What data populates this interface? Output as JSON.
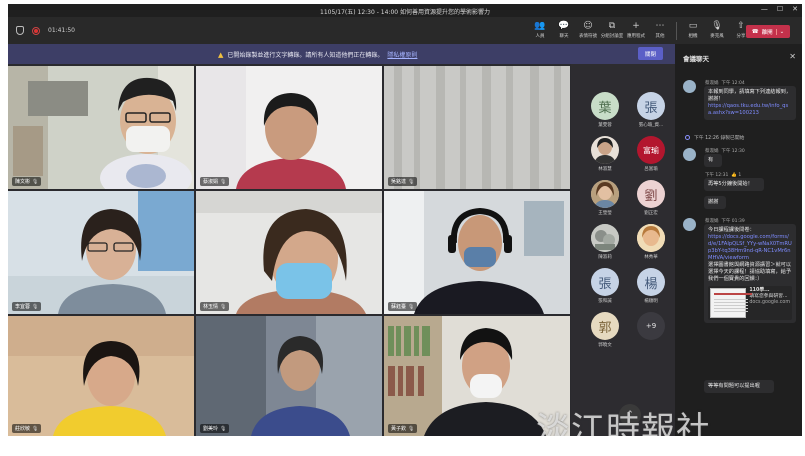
{
  "window": {
    "title": "1105/17(五) 12:30 - 14:00 如何善用資源提升您的學術影響力"
  },
  "toolbar": {
    "timer": "01:41:50",
    "items": [
      {
        "icon": "people-icon",
        "label": "人員"
      },
      {
        "icon": "chat-icon",
        "label": "聊天"
      },
      {
        "icon": "reactions-icon",
        "label": "表情符號"
      },
      {
        "icon": "rooms-icon",
        "label": "分組討論室"
      },
      {
        "icon": "apps-icon",
        "label": "應用程式"
      },
      {
        "icon": "more-icon",
        "label": "其他"
      },
      {
        "icon": "camera-icon",
        "label": "相機"
      },
      {
        "icon": "mic-icon",
        "label": "麥克風"
      },
      {
        "icon": "share-icon",
        "label": "分享"
      }
    ],
    "leave_label": "離開"
  },
  "banner": {
    "text": "已開始錄製並進行文字轉錄。請所有人知道他們正在轉錄。",
    "link": "隱私權原則",
    "dismiss_label": "關閉"
  },
  "participants": [
    {
      "name": "陳文彬"
    },
    {
      "name": "蔡淑娟"
    },
    {
      "name": "吳銘達"
    },
    {
      "name": "李宜蓉"
    },
    {
      "name": "林玉情"
    },
    {
      "name": "蘇鈺臺"
    },
    {
      "name": "莊欣敏"
    },
    {
      "name": "劉美玲"
    },
    {
      "name": "黃子欽"
    }
  ],
  "roster": [
    {
      "initial": "葉",
      "name": "葉雯蓉",
      "style": "init"
    },
    {
      "initial": "張",
      "name": "張心瑜_資...",
      "style": "init blue"
    },
    {
      "initial": "",
      "name": "林淑慧",
      "style": "photo"
    },
    {
      "initial": "富瑜",
      "name": "呂富瑜",
      "style": "photo-red"
    },
    {
      "initial": "",
      "name": "王瑩瑩",
      "style": "photo"
    },
    {
      "initial": "劉",
      "name": "劉正宏",
      "style": "init pink"
    },
    {
      "initial": "",
      "name": "陳淑莉",
      "style": "photo"
    },
    {
      "initial": "",
      "name": "林秀華",
      "style": "photo"
    },
    {
      "initial": "張",
      "name": "張和誠",
      "style": "init blue"
    },
    {
      "initial": "楊",
      "name": "楊順明",
      "style": "init blue"
    },
    {
      "initial": "郭",
      "name": "郭曉文",
      "style": "init tan"
    },
    {
      "initial": "+9",
      "name": "",
      "style": "more"
    }
  ],
  "chat": {
    "title": "會議聊天",
    "messages": [
      {
        "sender": "蔡淑娟",
        "time": "下午 12:04",
        "text": "本報到同學，請填寫下列連結報到，謝謝！",
        "link": "https://qaos.tku.edu.tw/info_qsa.ashx?sw=100213"
      },
      {
        "system": "下午 12:26   錄製已開始"
      },
      {
        "sender": "蔡淑娟",
        "time": "下午 12:30",
        "text": "有"
      },
      {
        "sender": "",
        "time": "下午 12:31",
        "text": "再等5分鐘後開始！",
        "reaction": "👍 1"
      },
      {
        "sender": "",
        "time": "",
        "text": "謝謝"
      },
      {
        "sender": "蔡淑娟",
        "time": "下午 01:39",
        "text": "今日課程課後問卷：",
        "link": "https://docs.google.com/forms/d/e/1FAIpQLSf_YYy-wNaX0TmRUp3bY-tq38Hm9nd-qR-NC1vMr6nMHVA/viewform",
        "text2": "選擇圖書館與網路資源講習＞就可以選擇今天的課程！請協助填寫，給予我們一個寶貴的回饋：）"
      },
      {
        "preview_title": "110學...",
        "preview_sub": "填寫您參與研習...",
        "preview_host": "docs.google.com"
      },
      {
        "sender": "",
        "time": "",
        "text": "等等有問題可以提出喔"
      }
    ]
  },
  "watermark": "淡江時報社",
  "colors": {
    "accent": "#5b5fc7",
    "leave": "#c4314b",
    "banner": "#3d3e66",
    "link": "#7f8cff"
  }
}
